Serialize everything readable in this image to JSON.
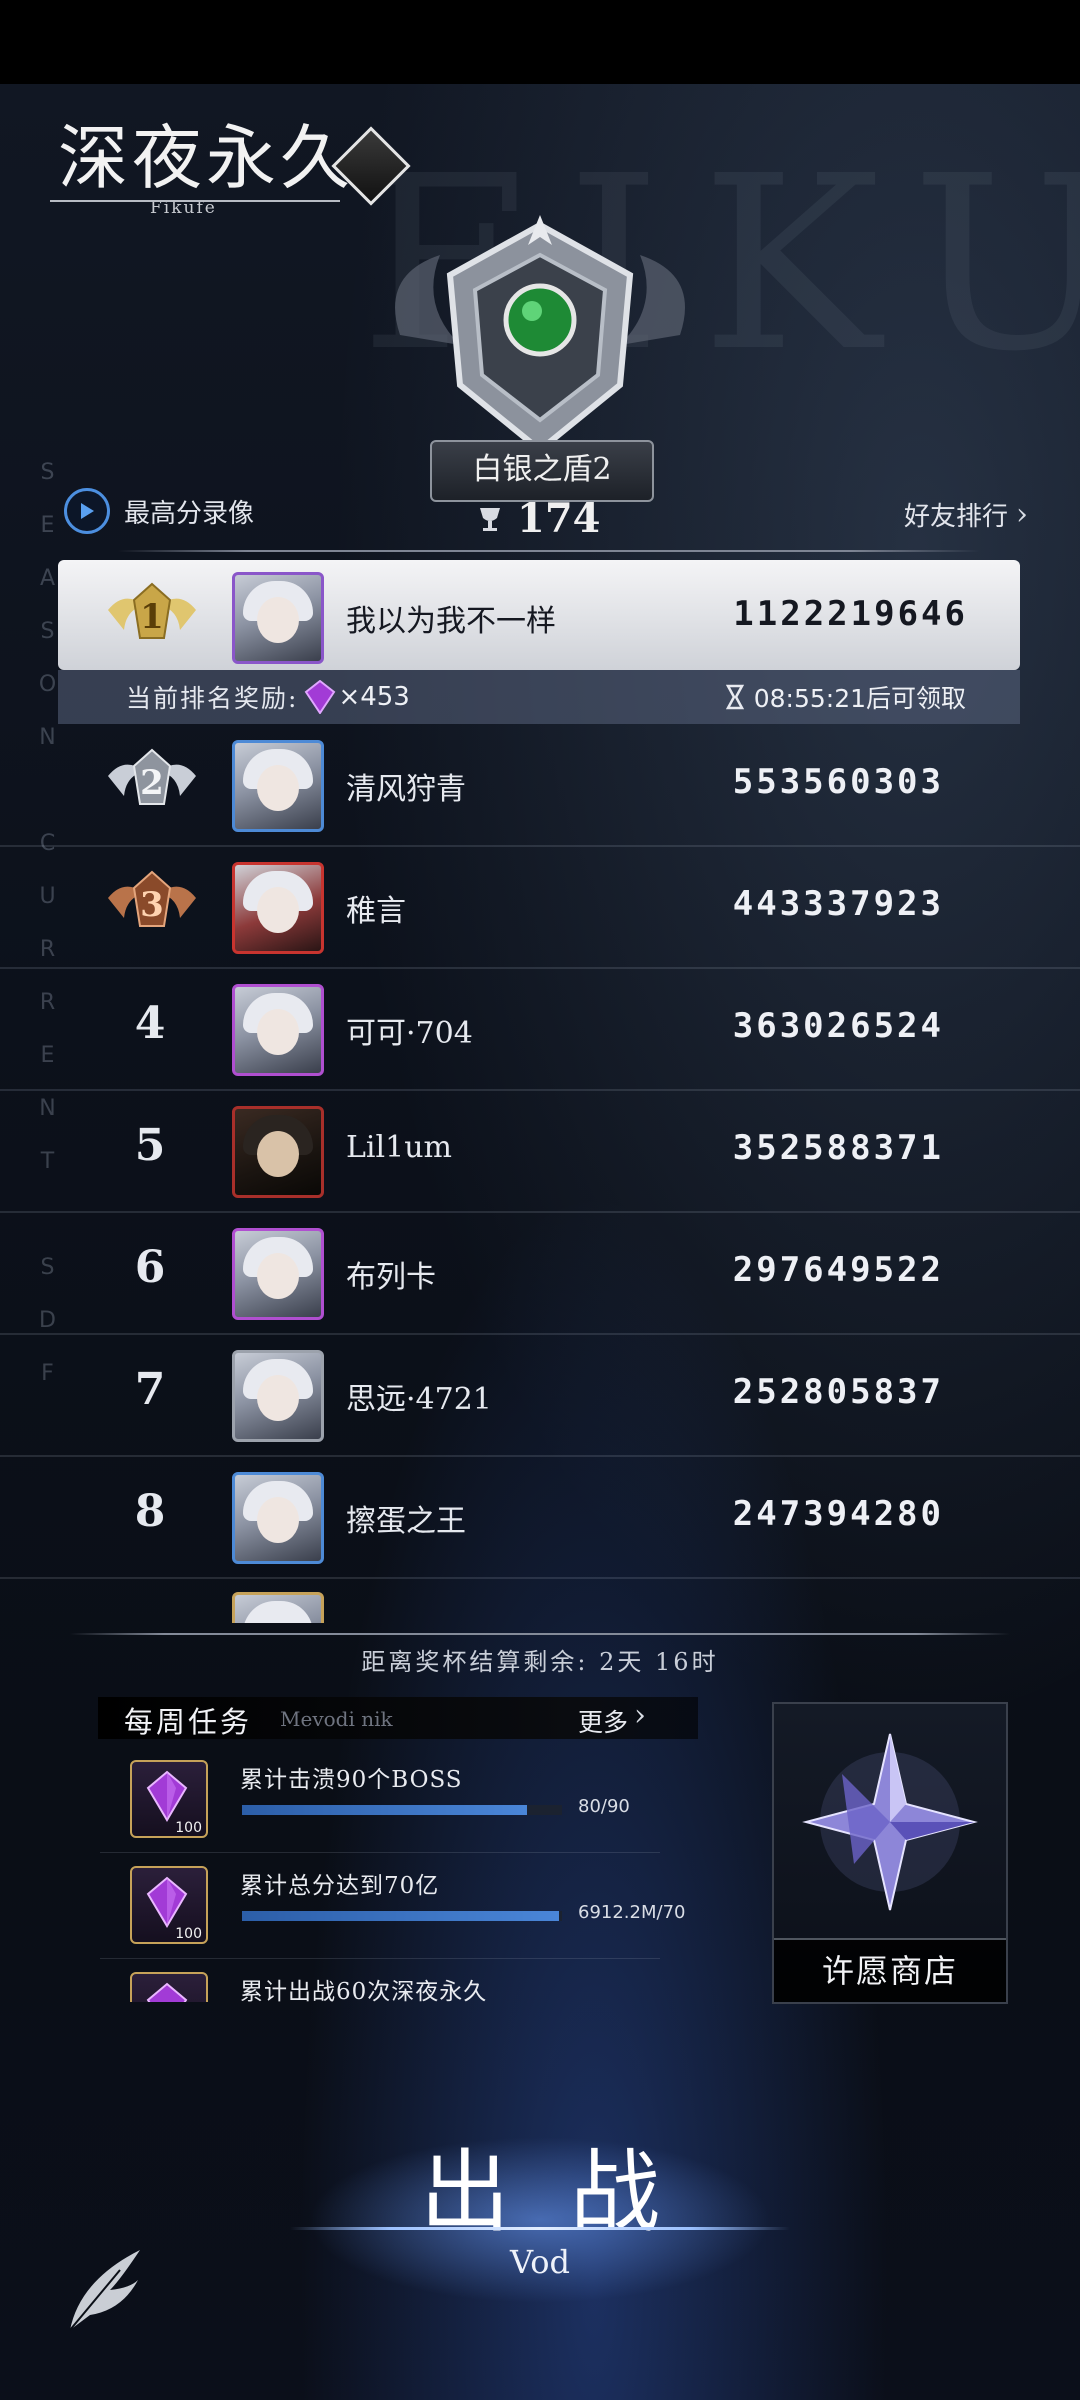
{
  "header": {
    "logo_title": "深夜永久",
    "logo_subtitle": "Fikufe",
    "bg_letters": "FIKU",
    "season_vertical": "SEASON CURRENT SDF",
    "rank_name": "白银之盾2",
    "trophies": "174",
    "record_label": "最高分录像",
    "friend_label": "好友排行"
  },
  "reward": {
    "label": "当前排名奖励:",
    "gem_count": "×453",
    "timer": "08:55:21后可领取"
  },
  "rankings": [
    {
      "rank": "1",
      "name": "我以为我不一样",
      "score": "1122219646"
    },
    {
      "rank": "2",
      "name": "清风狩青",
      "score": "553560303"
    },
    {
      "rank": "3",
      "name": "稚言",
      "score": "443337923"
    },
    {
      "rank": "4",
      "name": "可可·704",
      "score": "363026524"
    },
    {
      "rank": "5",
      "name": "Lil1um",
      "score": "352588371"
    },
    {
      "rank": "6",
      "name": "布列卡",
      "score": "297649522"
    },
    {
      "rank": "7",
      "name": "思远·4721",
      "score": "252805837"
    },
    {
      "rank": "8",
      "name": "擦蛋之王",
      "score": "247394280"
    }
  ],
  "countdown": "距离奖杯结算剩余: 2天 16时",
  "tasks": {
    "title": "每周任务",
    "subtitle": "Mevodi nik",
    "more_label": "更多",
    "items": [
      {
        "name": "累计击溃90个BOSS",
        "progress": "80/90",
        "fill": 0.89,
        "gem": "100"
      },
      {
        "name": "累计总分达到70亿",
        "progress": "6912.2M/70",
        "fill": 0.99,
        "gem": "100"
      },
      {
        "name": "累计出战60次深夜永久",
        "progress": "",
        "fill": 0,
        "gem": "100"
      }
    ]
  },
  "shop": {
    "label": "许愿商店"
  },
  "battle": {
    "title": "出战",
    "subtitle": "Vod"
  },
  "colors": {
    "gem": "#a23bd6",
    "accent_blue": "#4c8fe0",
    "gold": "#c6a259"
  }
}
